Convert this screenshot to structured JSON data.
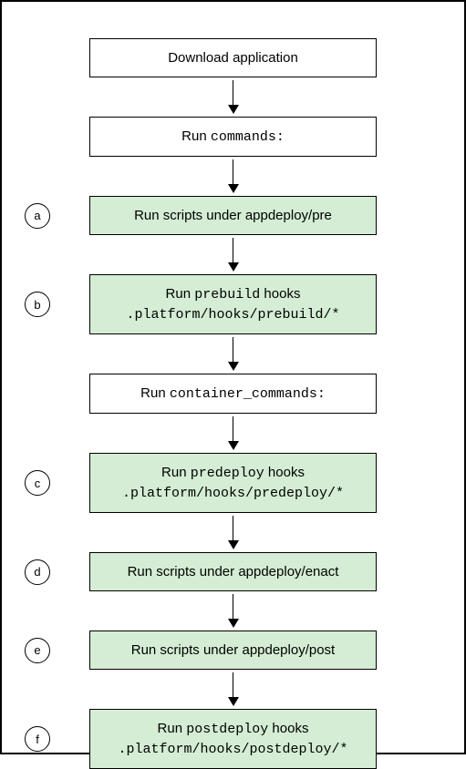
{
  "steps": [
    {
      "label": "",
      "style": "white",
      "line1": "Download application",
      "mono1": "",
      "line2": "",
      "mono2": ""
    },
    {
      "label": "",
      "style": "white",
      "line1": "Run ",
      "mono1": "commands:",
      "line2": "",
      "mono2": ""
    },
    {
      "label": "a",
      "style": "green",
      "line1": "Run scripts under appdeploy/pre",
      "mono1": "",
      "line2": "",
      "mono2": ""
    },
    {
      "label": "b",
      "style": "green",
      "line1": "Run ",
      "mono1": "prebuild",
      "line1suffix": " hooks",
      "line2": "",
      "mono2": ".platform/hooks/prebuild/*"
    },
    {
      "label": "",
      "style": "white",
      "line1": "Run ",
      "mono1": "container_commands:",
      "line2": "",
      "mono2": ""
    },
    {
      "label": "c",
      "style": "green",
      "line1": "Run ",
      "mono1": "predeploy",
      "line1suffix": " hooks",
      "line2": "",
      "mono2": ".platform/hooks/predeploy/*"
    },
    {
      "label": "d",
      "style": "green",
      "line1": "Run scripts under appdeploy/enact",
      "mono1": "",
      "line2": "",
      "mono2": ""
    },
    {
      "label": "e",
      "style": "green",
      "line1": "Run scripts under appdeploy/post",
      "mono1": "",
      "line2": "",
      "mono2": ""
    },
    {
      "label": "f",
      "style": "green",
      "line1": "Run ",
      "mono1": "postdeploy",
      "line1suffix": " hooks",
      "line2": "",
      "mono2": ".platform/hooks/postdeploy/*"
    }
  ]
}
